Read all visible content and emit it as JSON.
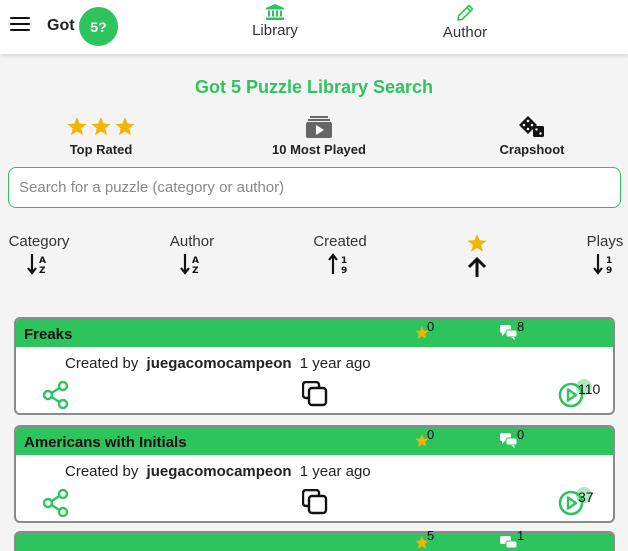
{
  "header": {
    "brand_text": "Got",
    "brand_badge": "5?",
    "nav": [
      {
        "label": "Library",
        "icon": "library-icon"
      },
      {
        "label": "Author",
        "icon": "pencil-icon"
      }
    ]
  },
  "search": {
    "title": "Got 5 Puzzle Library Search",
    "placeholder": "Search for a puzzle (category or author)",
    "value": ""
  },
  "quick_filters": [
    {
      "label": "Top Rated",
      "icon": "three-stars-icon"
    },
    {
      "label": "10 Most Played",
      "icon": "play-library-icon"
    },
    {
      "label": "Crapshoot",
      "icon": "dice-icon"
    }
  ],
  "sort": [
    {
      "label": "Category",
      "icon": "sort-alpha-down-icon"
    },
    {
      "label": "Author",
      "icon": "sort-alpha-down-icon"
    },
    {
      "label": "Created",
      "icon": "sort-numeric-up-icon"
    },
    {
      "label": "",
      "icon": "star-sort-up-icon"
    },
    {
      "label": "Plays",
      "icon": "sort-numeric-down-icon"
    }
  ],
  "puzzles": [
    {
      "title": "Freaks",
      "stars": "0",
      "comments": "8",
      "created_by": "Created by",
      "author": "juegacomocampeon",
      "age": "1 year ago",
      "plays": "110"
    },
    {
      "title": "Americans with Initials",
      "stars": "0",
      "comments": "0",
      "created_by": "Created by",
      "author": "juegacomocampeon",
      "age": "1 year ago",
      "plays": "37"
    },
    {
      "title": "",
      "stars": "5",
      "comments": "1"
    }
  ],
  "colors": {
    "accent": "#2ec45d",
    "star": "#f2b400",
    "card_border": "#8b8b8b"
  }
}
